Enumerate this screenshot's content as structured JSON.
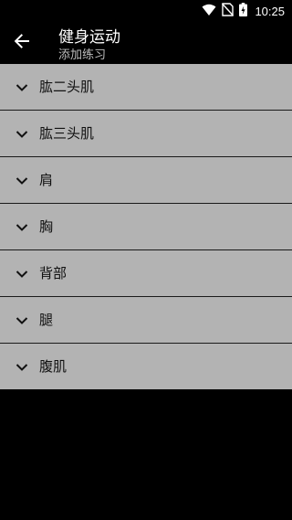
{
  "status_bar": {
    "time": "10:25",
    "icons": [
      "wifi-icon",
      "no-sim-icon",
      "battery-charging-icon"
    ]
  },
  "toolbar": {
    "back_icon": "arrow-back-icon",
    "title": "健身运动",
    "subtitle": "添加练习"
  },
  "categories": [
    {
      "label": "肱二头肌",
      "icon": "chevron-down-icon"
    },
    {
      "label": "肱三头肌",
      "icon": "chevron-down-icon"
    },
    {
      "label": "肩",
      "icon": "chevron-down-icon"
    },
    {
      "label": "胸",
      "icon": "chevron-down-icon"
    },
    {
      "label": "背部",
      "icon": "chevron-down-icon"
    },
    {
      "label": "腿",
      "icon": "chevron-down-icon"
    },
    {
      "label": "腹肌",
      "icon": "chevron-down-icon"
    }
  ],
  "colors": {
    "background": "#000000",
    "list_item_background": "#b3b3b3",
    "divider": "#1a1a1a",
    "title": "#ffffff",
    "subtitle": "#bdbdbd"
  }
}
